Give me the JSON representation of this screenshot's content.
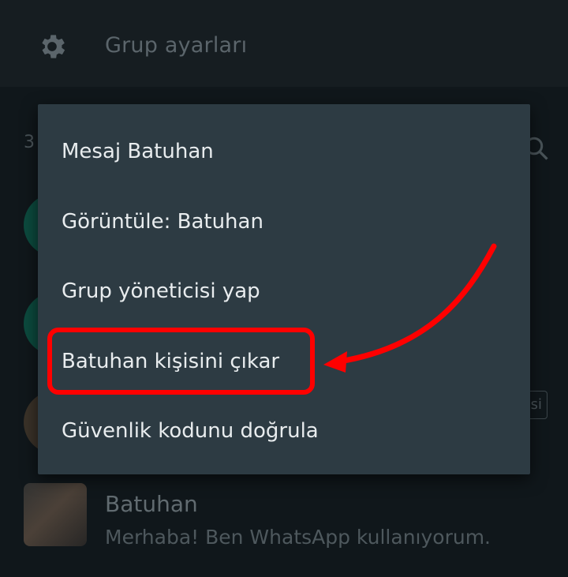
{
  "header": {
    "title": "Grup ayarları",
    "icon": "gear-icon"
  },
  "background": {
    "participant_count": "3",
    "admin_badge": "si",
    "contact": {
      "name": "Batuhan",
      "status": "Merhaba! Ben WhatsApp kullanıyorum."
    }
  },
  "menu": {
    "items": [
      {
        "label": "Mesaj Batuhan"
      },
      {
        "label": "Görüntüle: Batuhan"
      },
      {
        "label": "Grup yöneticisi yap"
      },
      {
        "label": "Batuhan kişisini çıkar"
      },
      {
        "label": "Güvenlik kodunu doğrula"
      }
    ]
  },
  "colors": {
    "menu_bg": "#2d3b43",
    "header_bg": "#161d21",
    "annotation": "#ff0000"
  }
}
